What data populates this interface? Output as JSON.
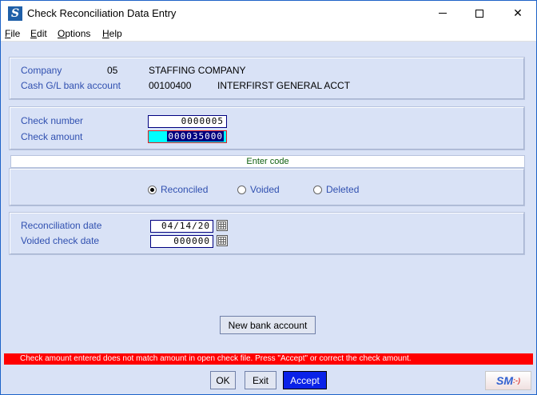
{
  "window": {
    "title": "Check Reconciliation Data Entry",
    "app_icon_letter": "S",
    "minimize": "–",
    "maximize": "□",
    "close": "✕"
  },
  "menu": [
    "File",
    "Edit",
    "Options",
    "Help"
  ],
  "company": {
    "company_label": "Company",
    "company_code": "05",
    "company_name": "STAFFING COMPANY",
    "account_label": "Cash G/L bank account",
    "account_number": "00100400",
    "account_name": "INTERFIRST GENERAL ACCT"
  },
  "check": {
    "number_label": "Check number",
    "number_value": "0000005",
    "amount_label": "Check amount",
    "amount_value": "000035000"
  },
  "code": {
    "header": "Enter code",
    "options": [
      "Reconciled",
      "Voided",
      "Deleted"
    ],
    "selected": "Reconciled"
  },
  "dates": {
    "reconciliation_label": "Reconciliation date",
    "reconciliation_value": "04/14/20",
    "voided_label": "Voided check date",
    "voided_value": "000000"
  },
  "buttons": {
    "new_bank_account": "New bank account",
    "ok": "OK",
    "exit": "Exit",
    "accept": "Accept"
  },
  "status_message": "Check amount entered does not match amount in open check file.  Press \"Accept\" or correct the check amount.",
  "logo": {
    "text": "SM",
    "suffix": ":-)"
  },
  "colors": {
    "background": "#d9e2f6",
    "label": "#3050b0",
    "error": "#ff0000",
    "accept_button": "#0a22e8",
    "active_field": "#00ffff"
  }
}
